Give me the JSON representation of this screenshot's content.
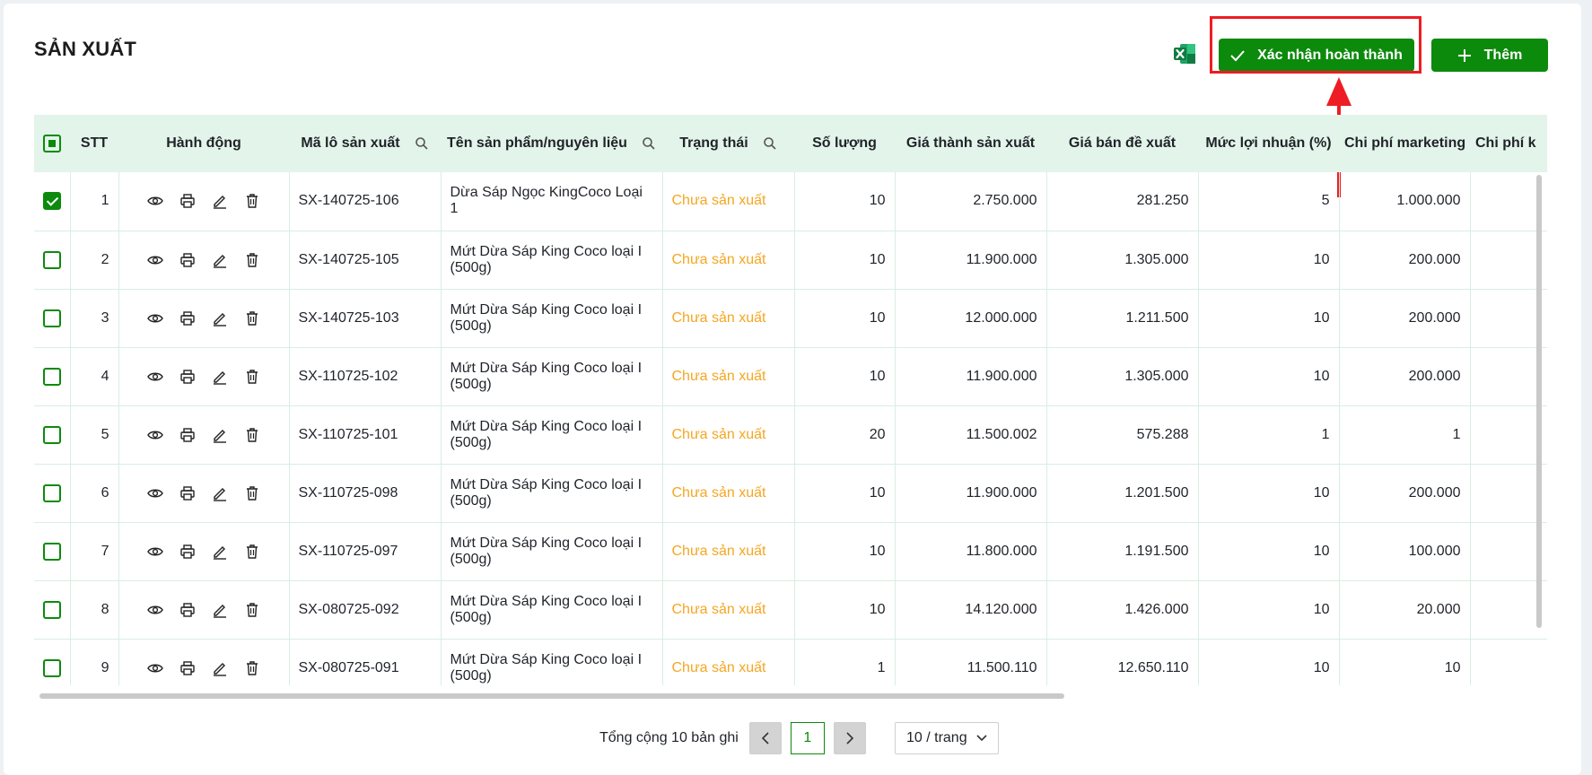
{
  "page": {
    "title": "SẢN XUẤT"
  },
  "toolbar": {
    "confirm_label": "Xác nhận hoàn thành",
    "add_label": "Thêm",
    "excel_icon": "excel-icon"
  },
  "colors": {
    "primary_green": "#0c8a0c",
    "header_bg": "#e3f4ea",
    "status_pending": "#f5a623",
    "annotation_red": "#ee1c24"
  },
  "table": {
    "headers": {
      "stt": "STT",
      "actions": "Hành động",
      "lot": "Mã lô sản xuất",
      "product": "Tên sản phẩm/nguyên liệu",
      "status": "Trạng thái",
      "qty": "Số lượng",
      "cost": "Giá thành sản xuất",
      "price": "Giá bán đề xuất",
      "margin": "Mức lợi nhuận (%)",
      "marketing": "Chi phí marketing",
      "other": "Chi phí k"
    },
    "rows": [
      {
        "stt": "1",
        "checked": true,
        "lot": "SX-140725-106",
        "product": "Dừa Sáp Ngọc KingCoco Loại 1",
        "status": "Chưa sản xuất",
        "qty": "10",
        "cost": "2.750.000",
        "price": "281.250",
        "margin": "5",
        "marketing": "1.000.000"
      },
      {
        "stt": "2",
        "checked": false,
        "lot": "SX-140725-105",
        "product": "Mứt Dừa Sáp King Coco loại I (500g)",
        "status": "Chưa sản xuất",
        "qty": "10",
        "cost": "11.900.000",
        "price": "1.305.000",
        "margin": "10",
        "marketing": "200.000"
      },
      {
        "stt": "3",
        "checked": false,
        "lot": "SX-140725-103",
        "product": "Mứt Dừa Sáp King Coco loại I (500g)",
        "status": "Chưa sản xuất",
        "qty": "10",
        "cost": "12.000.000",
        "price": "1.211.500",
        "margin": "10",
        "marketing": "200.000"
      },
      {
        "stt": "4",
        "checked": false,
        "lot": "SX-110725-102",
        "product": "Mứt Dừa Sáp King Coco loại I (500g)",
        "status": "Chưa sản xuất",
        "qty": "10",
        "cost": "11.900.000",
        "price": "1.305.000",
        "margin": "10",
        "marketing": "200.000"
      },
      {
        "stt": "5",
        "checked": false,
        "lot": "SX-110725-101",
        "product": "Mứt Dừa Sáp King Coco loại I (500g)",
        "status": "Chưa sản xuất",
        "qty": "20",
        "cost": "11.500.002",
        "price": "575.288",
        "margin": "1",
        "marketing": "1"
      },
      {
        "stt": "6",
        "checked": false,
        "lot": "SX-110725-098",
        "product": "Mứt Dừa Sáp King Coco loại I (500g)",
        "status": "Chưa sản xuất",
        "qty": "10",
        "cost": "11.900.000",
        "price": "1.201.500",
        "margin": "10",
        "marketing": "200.000"
      },
      {
        "stt": "7",
        "checked": false,
        "lot": "SX-110725-097",
        "product": "Mứt Dừa Sáp King Coco loại I (500g)",
        "status": "Chưa sản xuất",
        "qty": "10",
        "cost": "11.800.000",
        "price": "1.191.500",
        "margin": "10",
        "marketing": "100.000"
      },
      {
        "stt": "8",
        "checked": false,
        "lot": "SX-080725-092",
        "product": "Mứt Dừa Sáp King Coco loại I (500g)",
        "status": "Chưa sản xuất",
        "qty": "10",
        "cost": "14.120.000",
        "price": "1.426.000",
        "margin": "10",
        "marketing": "20.000"
      },
      {
        "stt": "9",
        "checked": false,
        "lot": "SX-080725-091",
        "product": "Mứt Dừa Sáp King Coco loại I (500g)",
        "status": "Chưa sản xuất",
        "qty": "1",
        "cost": "11.500.110",
        "price": "12.650.110",
        "margin": "10",
        "marketing": "10"
      }
    ]
  },
  "pagination": {
    "total_label": "Tổng cộng 10 bản ghi",
    "current_page": "1",
    "page_size": "10 / trang"
  }
}
